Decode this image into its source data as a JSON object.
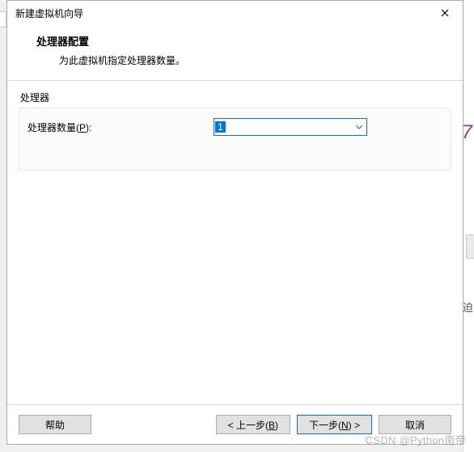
{
  "window": {
    "title": "新建虚拟机向导"
  },
  "header": {
    "title": "处理器配置",
    "subtitle": "为此虚拟机指定处理器数量。"
  },
  "group": {
    "label": "处理器",
    "field_label_pre": "处理器数量(",
    "field_label_key": "P",
    "field_label_post": "):",
    "combo_value": "1"
  },
  "footer": {
    "help": "帮助",
    "back_pre": "< 上一步(",
    "back_key": "B",
    "back_post": ")",
    "next_pre": "下一步(",
    "next_key": "N",
    "next_post": ") >",
    "cancel": "取消"
  },
  "watermark": "CSDN @Python南帝"
}
